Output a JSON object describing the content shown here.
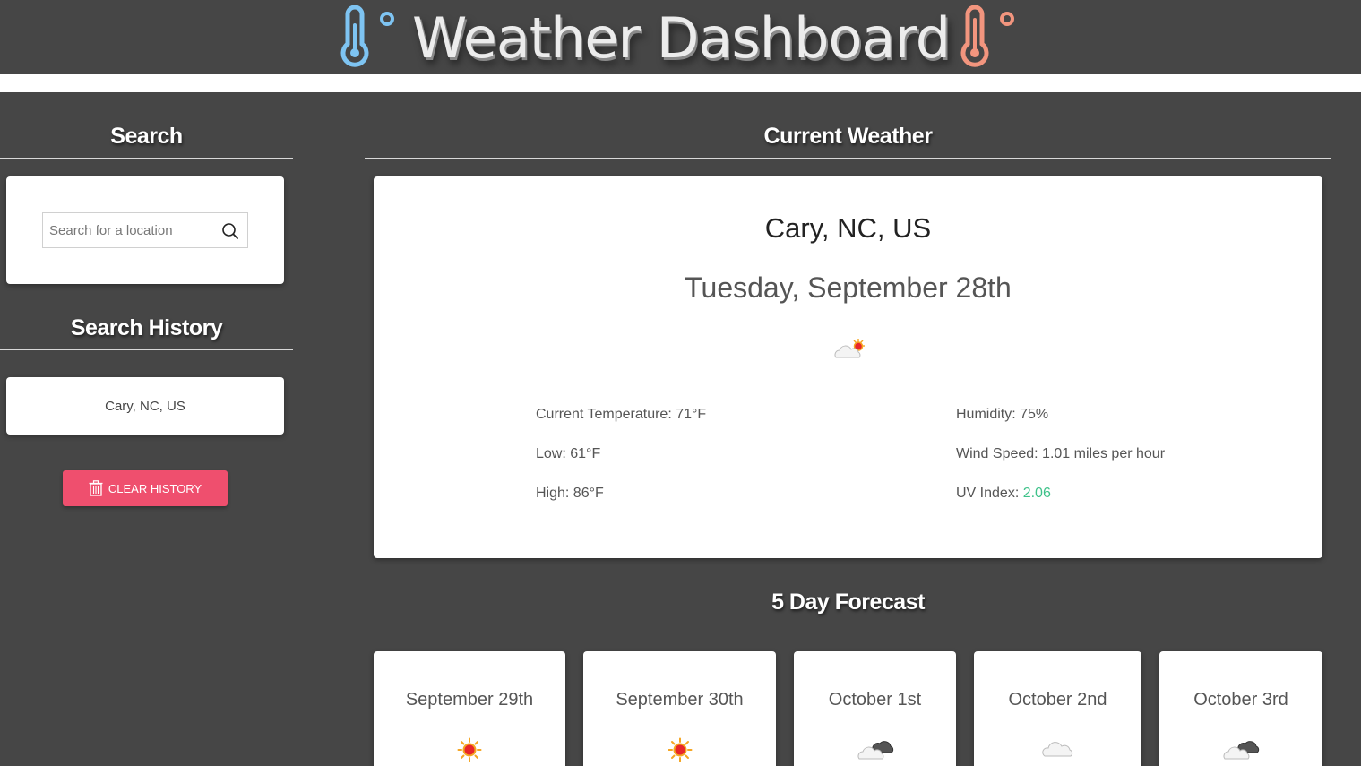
{
  "header": {
    "title": "Weather Dashboard",
    "cold_icon_color": "#7ec4f2",
    "hot_icon_color": "#f2957e"
  },
  "search": {
    "heading": "Search",
    "placeholder": "Search for a location",
    "icon": "search-icon"
  },
  "history": {
    "heading": "Search History",
    "items": [
      {
        "label": "Cary, NC, US"
      }
    ],
    "clear_label": "CLEAR HISTORY",
    "clear_color": "#ef4f6e"
  },
  "current": {
    "heading": "Current Weather",
    "city": "Cary, NC, US",
    "date": "Tuesday, September 28th",
    "icon": "partly-cloudy-sun-icon",
    "temperature": "Current Temperature: 71°F",
    "low": "Low: 61°F",
    "high": "High: 86°F",
    "humidity": "Humidity: 75%",
    "wind": "Wind Speed: 1.01 miles per hour",
    "uv_label": "UV Index: ",
    "uv_value": "2.06",
    "uv_color": "#3fc28a"
  },
  "forecast": {
    "heading": "5 Day Forecast",
    "days": [
      {
        "date": "September 29th",
        "icon": "sun-icon"
      },
      {
        "date": "September 30th",
        "icon": "sun-icon"
      },
      {
        "date": "October 1st",
        "icon": "dark-cloud-icon"
      },
      {
        "date": "October 2nd",
        "icon": "cloud-icon"
      },
      {
        "date": "October 3rd",
        "icon": "dark-cloud-icon"
      }
    ]
  }
}
